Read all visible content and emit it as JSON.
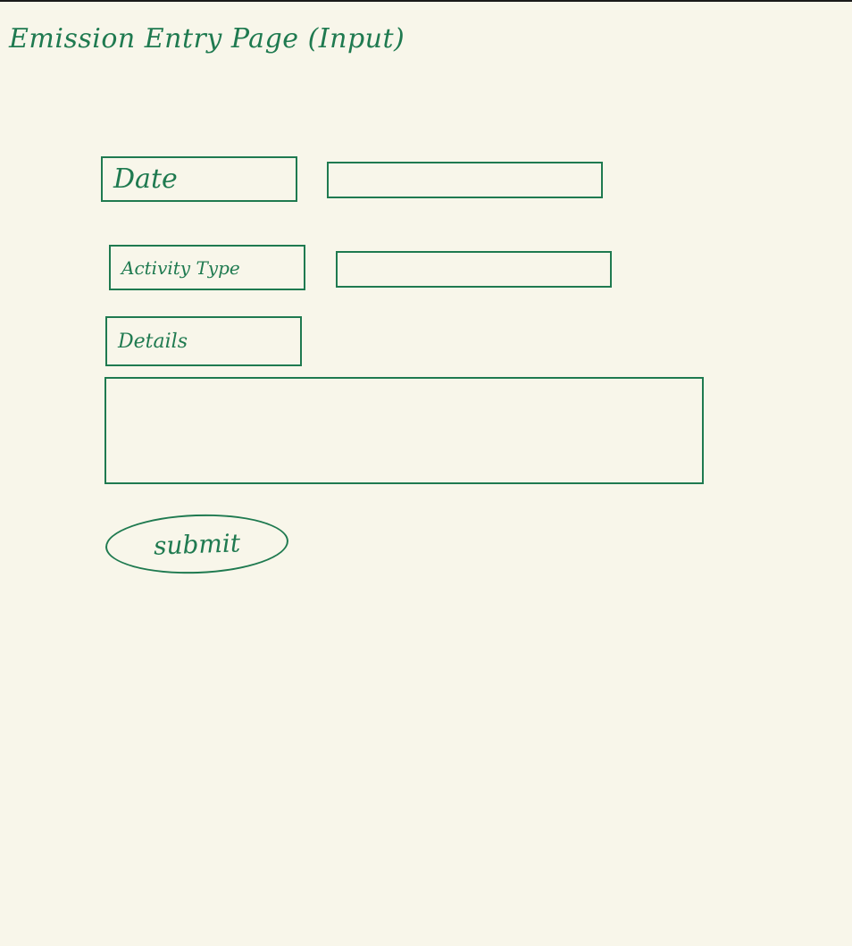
{
  "page": {
    "title": "Emission Entry Page (Input)"
  },
  "form": {
    "date_label": "Date",
    "date_value": "",
    "activity_label": "Activity Type",
    "activity_value": "",
    "details_label": "Details",
    "details_value": "",
    "submit_label": "submit"
  },
  "colors": {
    "ink": "#1f7a50",
    "paper": "#f8f6ea"
  }
}
